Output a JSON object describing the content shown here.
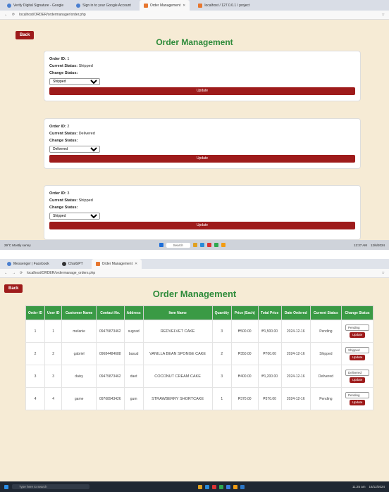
{
  "top": {
    "tabs": [
      "Verify Digital Signature - Google",
      "Sign in to your Google Account",
      "Order Management",
      "localhost / 127.0.0.1 / project"
    ],
    "url": "localhost/ORDER/ordermanager/order.php",
    "back_label": "Back",
    "title": "Order Management",
    "orders": [
      {
        "id_label": "Order ID:",
        "id": "1",
        "status_label": "Current Status:",
        "status": "Shipped",
        "change_label": "Change Status:",
        "selected": "Shipped",
        "update_label": "Update"
      },
      {
        "id_label": "Order ID:",
        "id": "2",
        "status_label": "Current Status:",
        "status": "Delivered",
        "change_label": "Change Status:",
        "selected": "Delivered",
        "update_label": "Update"
      },
      {
        "id_label": "Order ID:",
        "id": "3",
        "status_label": "Current Status:",
        "status": "Shipped",
        "change_label": "Change Status:",
        "selected": "Shipped",
        "update_label": "Update"
      }
    ],
    "taskbar": {
      "weather": "29°C Mostly sunny",
      "search": "Search",
      "time": "12:37 AM",
      "date": "12/6/2024"
    }
  },
  "bottom": {
    "tabs": [
      "Messenger | Facebook",
      "ChatGPT",
      "Order Management"
    ],
    "url": "localhost/ORDER/ordermanage_orders.php",
    "back_label": "Back",
    "title": "Order Management",
    "headers": [
      "Order ID",
      "User ID",
      "Customer Name",
      "Contact No.",
      "Address",
      "Item Name",
      "Quantity",
      "Price (Each)",
      "Total Price",
      "Date Ordered",
      "Current Status",
      "Change Status"
    ],
    "rows": [
      [
        "1",
        "1",
        "melanie",
        "09475873462",
        "sugcad",
        "REDVELVET CAKE",
        "3",
        "₱500.00",
        "₱1,500.00",
        "2024-12-16",
        "Pending",
        "Pending"
      ],
      [
        "2",
        "2",
        "gabriel",
        "09684484688",
        "basud",
        "VANILLA BEAN SPONGE CAKE",
        "2",
        "₱350.00",
        "₱700.00",
        "2024-12-16",
        "Shipped",
        "Shipped"
      ],
      [
        "3",
        "3",
        "daisy",
        "09475873462",
        "daet",
        "COCONUT CREAM CAKE",
        "3",
        "₱400.00",
        "₱1,200.00",
        "2024-12-16",
        "Delivered",
        "Delivered"
      ],
      [
        "4",
        "4",
        "game",
        "09768943426",
        "gum",
        "STRAWBERRY SHORTCAKE",
        "1",
        "₱370.00",
        "₱370.00",
        "2024-12-16",
        "Pending",
        "Pending"
      ]
    ],
    "update_label": "Update",
    "taskbar": {
      "search": "Type here to search",
      "time": "11:25 am",
      "date": "16/12/2024"
    }
  },
  "colors": {
    "accent_red": "#9e1b1b",
    "title_green": "#2e8b3a",
    "header_green": "#3a9a45",
    "page_bg": "#f6ebd5"
  }
}
